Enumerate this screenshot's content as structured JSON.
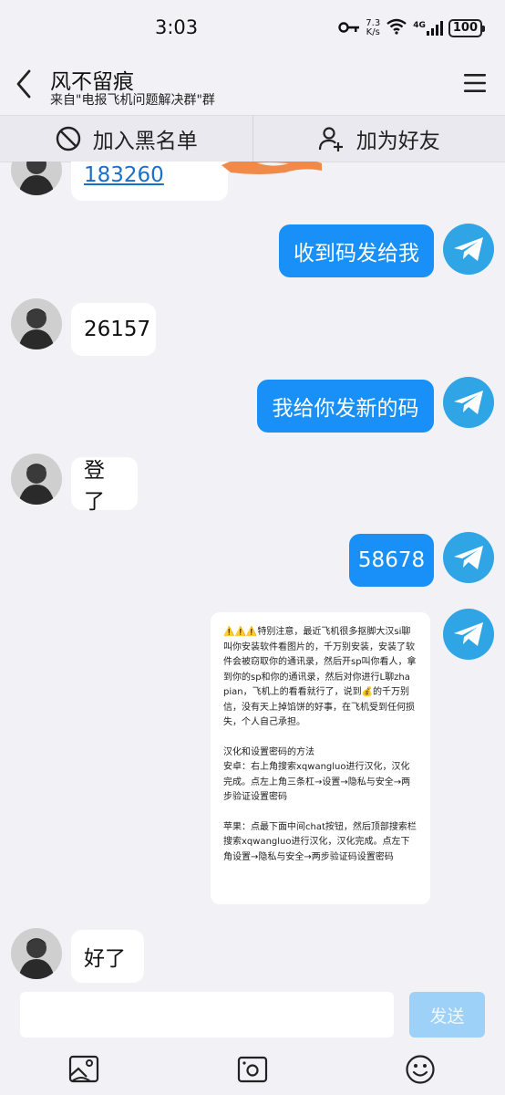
{
  "status": {
    "time": "3:03",
    "net_speed_value": "7.3",
    "net_speed_unit": "K/s",
    "signal_label": "4G",
    "battery": "100"
  },
  "header": {
    "name": "风不留痕",
    "subtitle": "来自\"电报飞机问题解决群\"群"
  },
  "actions": {
    "block_label": "加入黑名单",
    "add_friend_label": "加为好友"
  },
  "messages": [
    {
      "side": "in",
      "type": "phone",
      "text": "183260"
    },
    {
      "side": "out",
      "type": "text",
      "text": "收到码发给我"
    },
    {
      "side": "in",
      "type": "text",
      "text": "26157"
    },
    {
      "side": "out",
      "type": "text",
      "text": "我给你发新的码"
    },
    {
      "side": "in",
      "type": "text",
      "text": "登了"
    },
    {
      "side": "out",
      "type": "text",
      "text": "58678"
    },
    {
      "side": "out",
      "type": "image"
    },
    {
      "side": "in",
      "type": "text",
      "text": "好了"
    }
  ],
  "image_card": {
    "warning_emojis": "⚠️⚠️⚠️",
    "paragraph1": "特别注意，最近飞机很多抠脚大汉si聊叫你安装软件看图片的，千万别安装，安装了软件会被窃取你的通讯录，然后开sp叫你看人，拿到你的sp和你的通讯录，然后对你进行L聊zha pian，飞机上的看看就行了，说到💰的千万别信，没有天上掉馅饼的好事，在飞机受到任何损失，个人自己承担。",
    "heading": "汉化和设置密码的方法",
    "android": "安卓：右上角搜索xqwangluo进行汉化，汉化完成。点左上角三条杠→设置→隐私与安全→两步验证设置密码",
    "apple": "苹果：点最下面中间chat按钮，然后顶部搜索栏搜索xqwangluo进行汉化，汉化完成。点左下角设置→隐私与安全→两步验证码设置密码"
  },
  "input": {
    "placeholder": "",
    "send_label": "发送"
  },
  "colors": {
    "accent": "#1890f7",
    "telegram": "#30a5e6",
    "send_disabled": "#9ed1f7",
    "background": "#f2f2f6",
    "redaction": "#f08a4b"
  }
}
